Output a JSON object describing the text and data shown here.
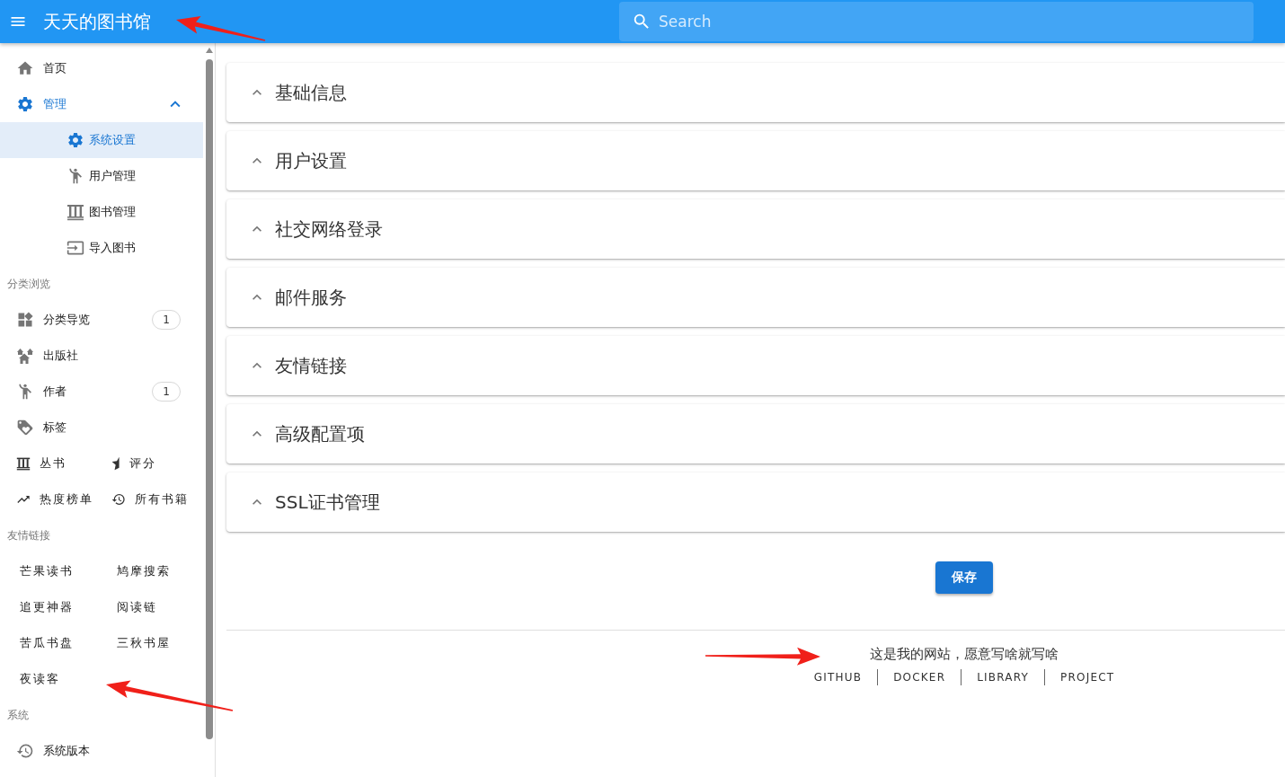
{
  "app_bar": {
    "title": "天天的图书馆",
    "search": {
      "placeholder": "Search"
    }
  },
  "sidebar": {
    "menu": [
      {
        "label": "首页",
        "selected": false
      },
      {
        "label": "管理",
        "selected": false,
        "expanded": true,
        "children": [
          {
            "label": "系统设置",
            "selected": true
          },
          {
            "label": "用户管理",
            "selected": false
          },
          {
            "label": "图书管理",
            "selected": false
          },
          {
            "label": "导入图书",
            "selected": false
          }
        ]
      }
    ],
    "browse": {
      "heading": "分类浏览",
      "items": [
        {
          "label": "分类导览",
          "selected": false,
          "badge": "1"
        },
        {
          "label": "出版社",
          "selected": false
        },
        {
          "label": "作者",
          "selected": false,
          "badge": "1"
        },
        {
          "label": "标签",
          "selected": false
        }
      ],
      "grid_items": [
        {
          "label": "丛书",
          "selected": false
        },
        {
          "label": "评分",
          "selected": false
        },
        {
          "label": "热度榜单",
          "selected": false
        },
        {
          "label": "所有书籍",
          "selected": false
        }
      ]
    },
    "friend_links": {
      "heading": "友情链接",
      "items": [
        "芒果读书",
        "鸠摩搜索",
        "追更神器",
        "阅读链",
        "苦瓜书盘",
        "三秋书屋",
        "夜读客"
      ]
    },
    "system": {
      "heading": "系统",
      "items": [
        {
          "label": "系统版本",
          "selected": false
        }
      ]
    }
  },
  "panels": [
    {
      "title": "基础信息"
    },
    {
      "title": "用户设置"
    },
    {
      "title": "社交网络登录"
    },
    {
      "title": "邮件服务"
    },
    {
      "title": "友情链接"
    },
    {
      "title": "高级配置项"
    },
    {
      "title": "SSL证书管理"
    }
  ],
  "save_button": "保存",
  "footer": {
    "text": "这是我的网站，愿意写啥就写啥",
    "links": [
      "GITHUB",
      "DOCKER",
      "LIBRARY",
      "PROJECT"
    ]
  }
}
